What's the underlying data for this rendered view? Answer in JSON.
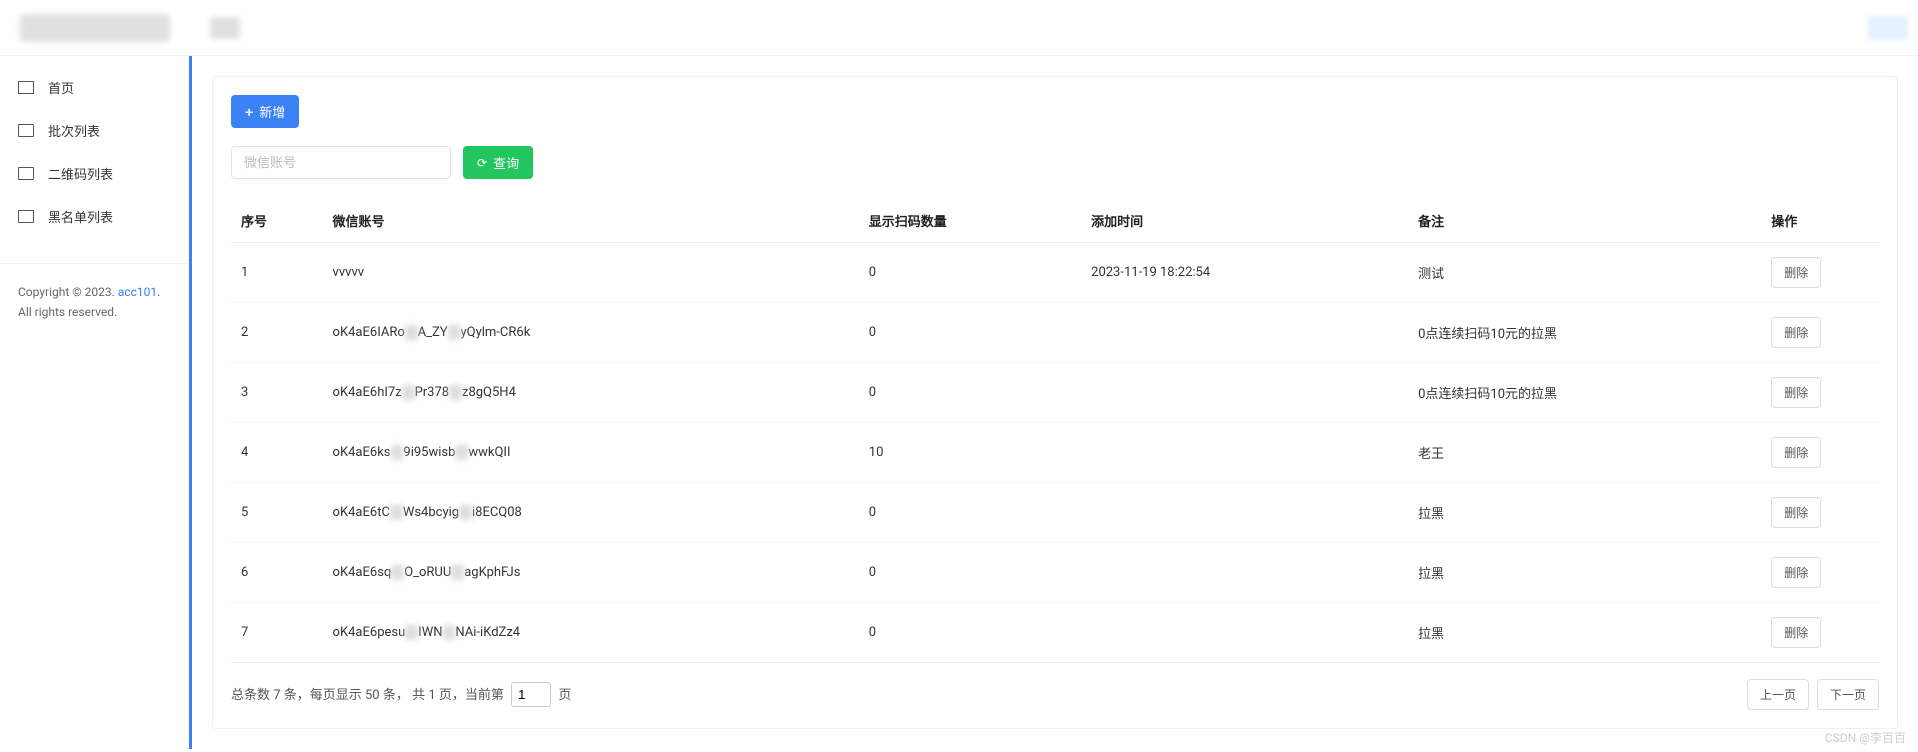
{
  "sidebar": {
    "items": [
      {
        "label": "首页"
      },
      {
        "label": "批次列表"
      },
      {
        "label": "二维码列表"
      },
      {
        "label": "黑名单列表"
      }
    ],
    "footer": {
      "copyright": "Copyright © 2023. ",
      "link": "acc101",
      "rights": "All rights reserved."
    }
  },
  "toolbar": {
    "add_label": "新增",
    "search_placeholder": "微信账号",
    "search_label": "查询"
  },
  "table": {
    "headers": {
      "index": "序号",
      "account": "微信账号",
      "scan_count": "显示扫码数量",
      "add_time": "添加时间",
      "note": "备注",
      "action": "操作"
    },
    "delete_label": "删除",
    "rows": [
      {
        "index": "1",
        "account_pre": "vvvvv",
        "account_mid": "",
        "account_post": "",
        "count": "0",
        "time": "2023-11-19 18:22:54",
        "note": "测试"
      },
      {
        "index": "2",
        "account_pre": "oK4aE6IARo",
        "account_mid": "A_ZY",
        "account_post": "yQylm-CR6k",
        "count": "0",
        "time": "",
        "note": "0点连续扫码10元的拉黑"
      },
      {
        "index": "3",
        "account_pre": "oK4aE6hI7z",
        "account_mid": "Pr378",
        "account_post": "z8gQ5H4",
        "count": "0",
        "time": "",
        "note": "0点连续扫码10元的拉黑"
      },
      {
        "index": "4",
        "account_pre": "oK4aE6ks",
        "account_mid": "9i95wisb",
        "account_post": "wwkQII",
        "count": "10",
        "time": "",
        "note": "老王"
      },
      {
        "index": "5",
        "account_pre": "oK4aE6tC",
        "account_mid": "Ws4bcyig",
        "account_post": "i8ECQ08",
        "count": "0",
        "time": "",
        "note": "拉黑"
      },
      {
        "index": "6",
        "account_pre": "oK4aE6sq",
        "account_mid": "O_oRUU",
        "account_post": "agKphFJs",
        "count": "0",
        "time": "",
        "note": "拉黑"
      },
      {
        "index": "7",
        "account_pre": "oK4aE6pesu",
        "account_mid": "IWN",
        "account_post": "NAi-iKdZz4",
        "count": "0",
        "time": "",
        "note": "拉黑"
      }
    ]
  },
  "pager": {
    "total_prefix": "总条数 ",
    "total": "7",
    "total_suffix": " 条，每页显示 ",
    "per_page": "50",
    "per_page_suffix": " 条，  共 ",
    "pages": "1",
    "pages_suffix": " 页，当前第",
    "current": "1",
    "current_suffix": "页",
    "prev": "上一页",
    "next": "下一页"
  },
  "watermark": "CSDN @李百百"
}
